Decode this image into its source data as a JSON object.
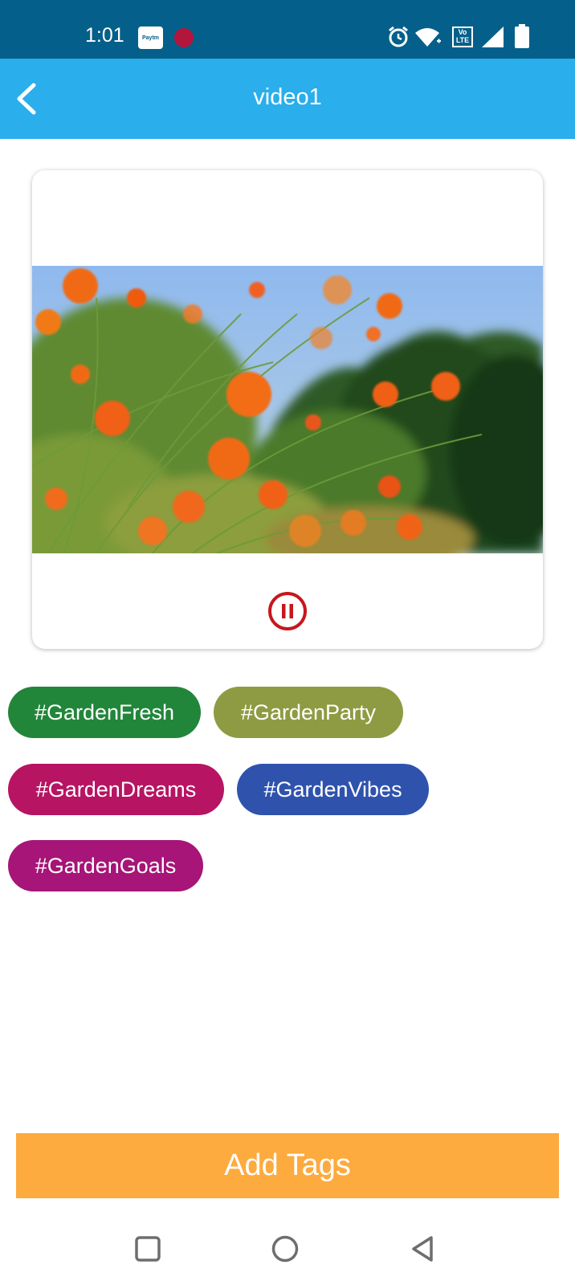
{
  "status_bar": {
    "time": "1:01",
    "paytm_label": "Paytm",
    "icons": [
      "paytm-icon",
      "notification-dot-icon",
      "alarm-icon",
      "wifi-icon",
      "volte-icon",
      "signal-icon",
      "battery-icon"
    ],
    "volte_label": "Vo LTE"
  },
  "app_bar": {
    "title": "video1",
    "background_color": "#2aaeec"
  },
  "video": {
    "thumbnail": "orange-flowers-image",
    "control": "pause-icon",
    "control_color": "#c8161d"
  },
  "tags": [
    {
      "label": "#GardenFresh",
      "color": "#22863a"
    },
    {
      "label": "#GardenParty",
      "color": "#8e9b42"
    },
    {
      "label": "#GardenDreams",
      "color": "#b71463"
    },
    {
      "label": "#GardenVibes",
      "color": "#2f53ad"
    },
    {
      "label": "#GardenGoals",
      "color": "#a61577"
    }
  ],
  "add_button": {
    "label": "Add Tags",
    "color": "#fdaa3e"
  },
  "nav_bar": {
    "buttons": [
      "recents-square-icon",
      "home-circle-icon",
      "back-triangle-icon"
    ]
  }
}
